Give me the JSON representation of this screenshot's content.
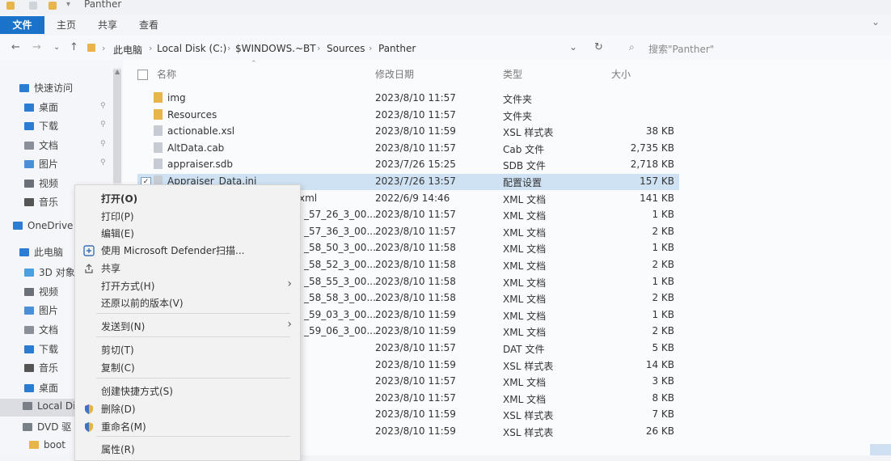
{
  "window": {
    "title": "Panther"
  },
  "ribbon": {
    "tabs": [
      "文件",
      "主页",
      "共享",
      "查看"
    ]
  },
  "address_bar": {
    "path": [
      "此电脑",
      "Local Disk (C:)",
      "$WINDOWS.~BT",
      "Sources",
      "Panther"
    ],
    "search_placeholder": "搜索\"Panther\""
  },
  "nav_pane": {
    "items": [
      {
        "label": "快速访问",
        "icon": "star-icon",
        "color": "#2b7cd3"
      },
      {
        "label": "桌面",
        "icon": "desktop-icon",
        "color": "#2b7cd3",
        "pinned": true
      },
      {
        "label": "下载",
        "icon": "download-icon",
        "color": "#2b7cd3",
        "pinned": true
      },
      {
        "label": "文档",
        "icon": "document-icon",
        "color": "#8a8f99",
        "pinned": true
      },
      {
        "label": "图片",
        "icon": "picture-icon",
        "color": "#4a90d9",
        "pinned": true
      },
      {
        "label": "视频",
        "icon": "video-icon",
        "color": "#6a6f78"
      },
      {
        "label": "音乐",
        "icon": "music-icon",
        "color": "#555"
      },
      {
        "label": "OneDrive",
        "icon": "cloud-icon",
        "color": "#2b7cd3"
      },
      {
        "label": "此电脑",
        "icon": "computer-icon",
        "color": "#2b7cd3"
      },
      {
        "label": "3D 对象",
        "icon": "cube-icon",
        "color": "#4aa0e0"
      },
      {
        "label": "视频",
        "icon": "video-icon",
        "color": "#6a6f78"
      },
      {
        "label": "图片",
        "icon": "picture-icon",
        "color": "#4a90d9"
      },
      {
        "label": "文档",
        "icon": "document-icon",
        "color": "#8a8f99"
      },
      {
        "label": "下载",
        "icon": "download-icon",
        "color": "#2b7cd3"
      },
      {
        "label": "音乐",
        "icon": "music-icon",
        "color": "#555"
      },
      {
        "label": "桌面",
        "icon": "desktop-icon",
        "color": "#2b7cd3"
      },
      {
        "label": "Local Di",
        "icon": "drive-icon",
        "color": "#7a8088"
      },
      {
        "label": "DVD 驱",
        "icon": "dvd-icon",
        "color": "#7a8088"
      },
      {
        "label": "boot",
        "icon": "folder-icon",
        "color": "#e8b54a"
      }
    ]
  },
  "file_list": {
    "columns": [
      "名称",
      "修改日期",
      "类型",
      "大小"
    ],
    "rows": [
      {
        "name": "img",
        "date": "2023/8/10 11:57",
        "type": "文件夹",
        "size": ""
      },
      {
        "name": "Resources",
        "date": "2023/8/10 11:57",
        "type": "文件夹",
        "size": ""
      },
      {
        "name": "actionable.xsl",
        "date": "2023/8/10 11:59",
        "type": "XSL 样式表",
        "size": "38 KB"
      },
      {
        "name": "AltData.cab",
        "date": "2023/8/10 11:57",
        "type": "Cab 文件",
        "size": "2,735 KB"
      },
      {
        "name": "appraiser.sdb",
        "date": "2023/7/26 15:25",
        "type": "SDB 文件",
        "size": "2,718 KB"
      },
      {
        "name": "Appraiser_Data.ini",
        "date": "2023/7/26 13:57",
        "type": "配置设置",
        "size": "157 KB"
      },
      {
        "name": "xml",
        "date": "2022/6/9 14:46",
        "type": "XML 文档",
        "size": "141 KB"
      },
      {
        "name": "_57_26_3_00...",
        "date": "2023/8/10 11:57",
        "type": "XML 文档",
        "size": "1 KB"
      },
      {
        "name": "_57_36_3_00...",
        "date": "2023/8/10 11:57",
        "type": "XML 文档",
        "size": "2 KB"
      },
      {
        "name": "_58_50_3_00...",
        "date": "2023/8/10 11:58",
        "type": "XML 文档",
        "size": "1 KB"
      },
      {
        "name": "_58_52_3_00...",
        "date": "2023/8/10 11:58",
        "type": "XML 文档",
        "size": "2 KB"
      },
      {
        "name": "_58_55_3_00...",
        "date": "2023/8/10 11:58",
        "type": "XML 文档",
        "size": "1 KB"
      },
      {
        "name": "_58_58_3_00...",
        "date": "2023/8/10 11:58",
        "type": "XML 文档",
        "size": "2 KB"
      },
      {
        "name": "_59_03_3_00...",
        "date": "2023/8/10 11:59",
        "type": "XML 文档",
        "size": "1 KB"
      },
      {
        "name": "_59_06_3_00...",
        "date": "2023/8/10 11:59",
        "type": "XML 文档",
        "size": "2 KB"
      },
      {
        "name": "",
        "date": "2023/8/10 11:57",
        "type": "DAT 文件",
        "size": "5 KB"
      },
      {
        "name": "",
        "date": "2023/8/10 11:59",
        "type": "XSL 样式表",
        "size": "14 KB"
      },
      {
        "name": "",
        "date": "2023/8/10 11:57",
        "type": "XML 文档",
        "size": "3 KB"
      },
      {
        "name": "",
        "date": "2023/8/10 11:57",
        "type": "XML 文档",
        "size": "8 KB"
      },
      {
        "name": "",
        "date": "2023/8/10 11:59",
        "type": "XSL 样式表",
        "size": "7 KB"
      },
      {
        "name": "",
        "date": "2023/8/10 11:59",
        "type": "XSL 样式表",
        "size": "26 KB"
      }
    ]
  },
  "context_menu": {
    "items": [
      {
        "label": "打开(O)",
        "bold": true
      },
      {
        "label": "打印(P)"
      },
      {
        "label": "编辑(E)"
      },
      {
        "label": "使用 Microsoft Defender扫描...",
        "icon": "defender-icon"
      },
      {
        "label": "共享",
        "icon": "share-icon"
      },
      {
        "label": "打开方式(H)",
        "submenu": true
      },
      {
        "label": "还原以前的版本(V)"
      },
      {
        "label": "发送到(N)",
        "submenu": true
      },
      {
        "label": "剪切(T)"
      },
      {
        "label": "复制(C)"
      },
      {
        "label": "创建快捷方式(S)"
      },
      {
        "label": "删除(D)",
        "icon": "shield-icon"
      },
      {
        "label": "重命名(M)",
        "icon": "shield-icon"
      },
      {
        "label": "属性(R)"
      }
    ]
  }
}
